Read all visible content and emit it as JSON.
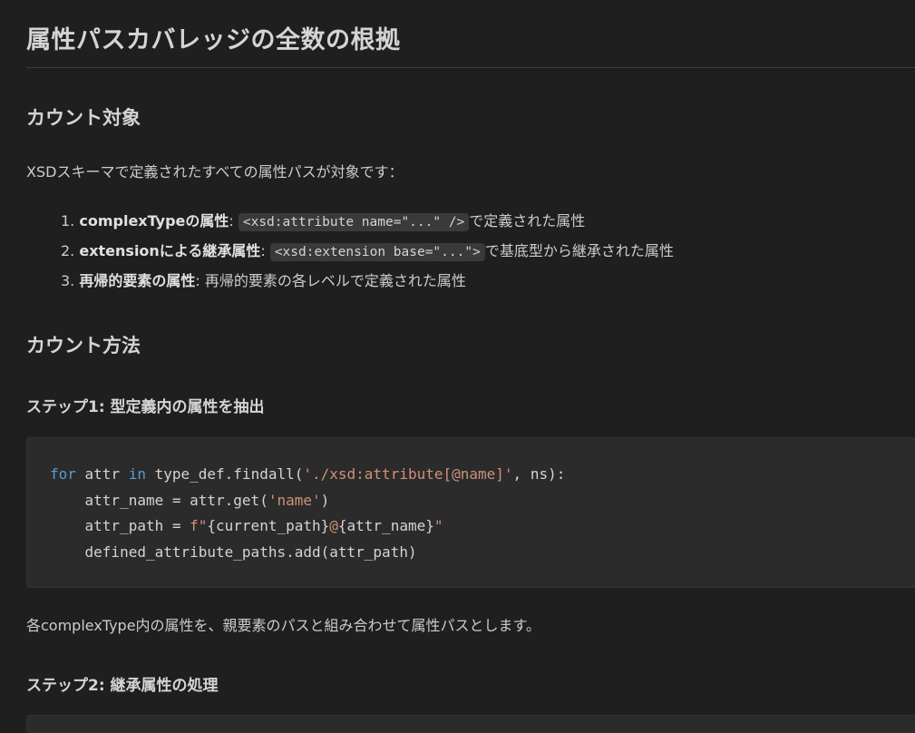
{
  "title": "属性パスカバレッジの全数の根拠",
  "section1": {
    "heading": "カウント対象",
    "intro": "XSDスキーマで定義されたすべての属性パスが対象です：",
    "items": [
      {
        "num": "1.",
        "bold": "complexTypeの属性",
        "sep": ": ",
        "code": "<xsd:attribute name=\"...\" />",
        "rest": "で定義された属性"
      },
      {
        "num": "2.",
        "bold": "extensionによる継承属性",
        "sep": ": ",
        "code": "<xsd:extension base=\"...\">",
        "rest": "で基底型から継承された属性"
      },
      {
        "num": "3.",
        "bold": "再帰的要素の属性",
        "sep": ": ",
        "code": "",
        "rest": "再帰的要素の各レベルで定義された属性"
      }
    ]
  },
  "section2": {
    "heading": "カウント方法",
    "step1": {
      "heading": "ステップ1: 型定義内の属性を抽出",
      "code": {
        "l1_kw_for": "for",
        "l1_a": " attr ",
        "l1_kw_in": "in",
        "l1_b": " type_def.findall(",
        "l1_str": "'./xsd:attribute[@name]'",
        "l1_c": ", ns):",
        "l2_a": "    attr_name = attr.get(",
        "l2_str": "'name'",
        "l2_b": ")",
        "l3_a": "    attr_path = ",
        "l3_f": "f\"",
        "l3_b": "{current_path}",
        "l3_at": "@",
        "l3_c": "{attr_name}",
        "l3_q": "\"",
        "l4": "    defined_attribute_paths.add(attr_path)"
      },
      "description": "各complexType内の属性を、親要素のパスと組み合わせて属性パスとします。"
    },
    "step2": {
      "heading": "ステップ2: 継承属性の処理"
    }
  }
}
